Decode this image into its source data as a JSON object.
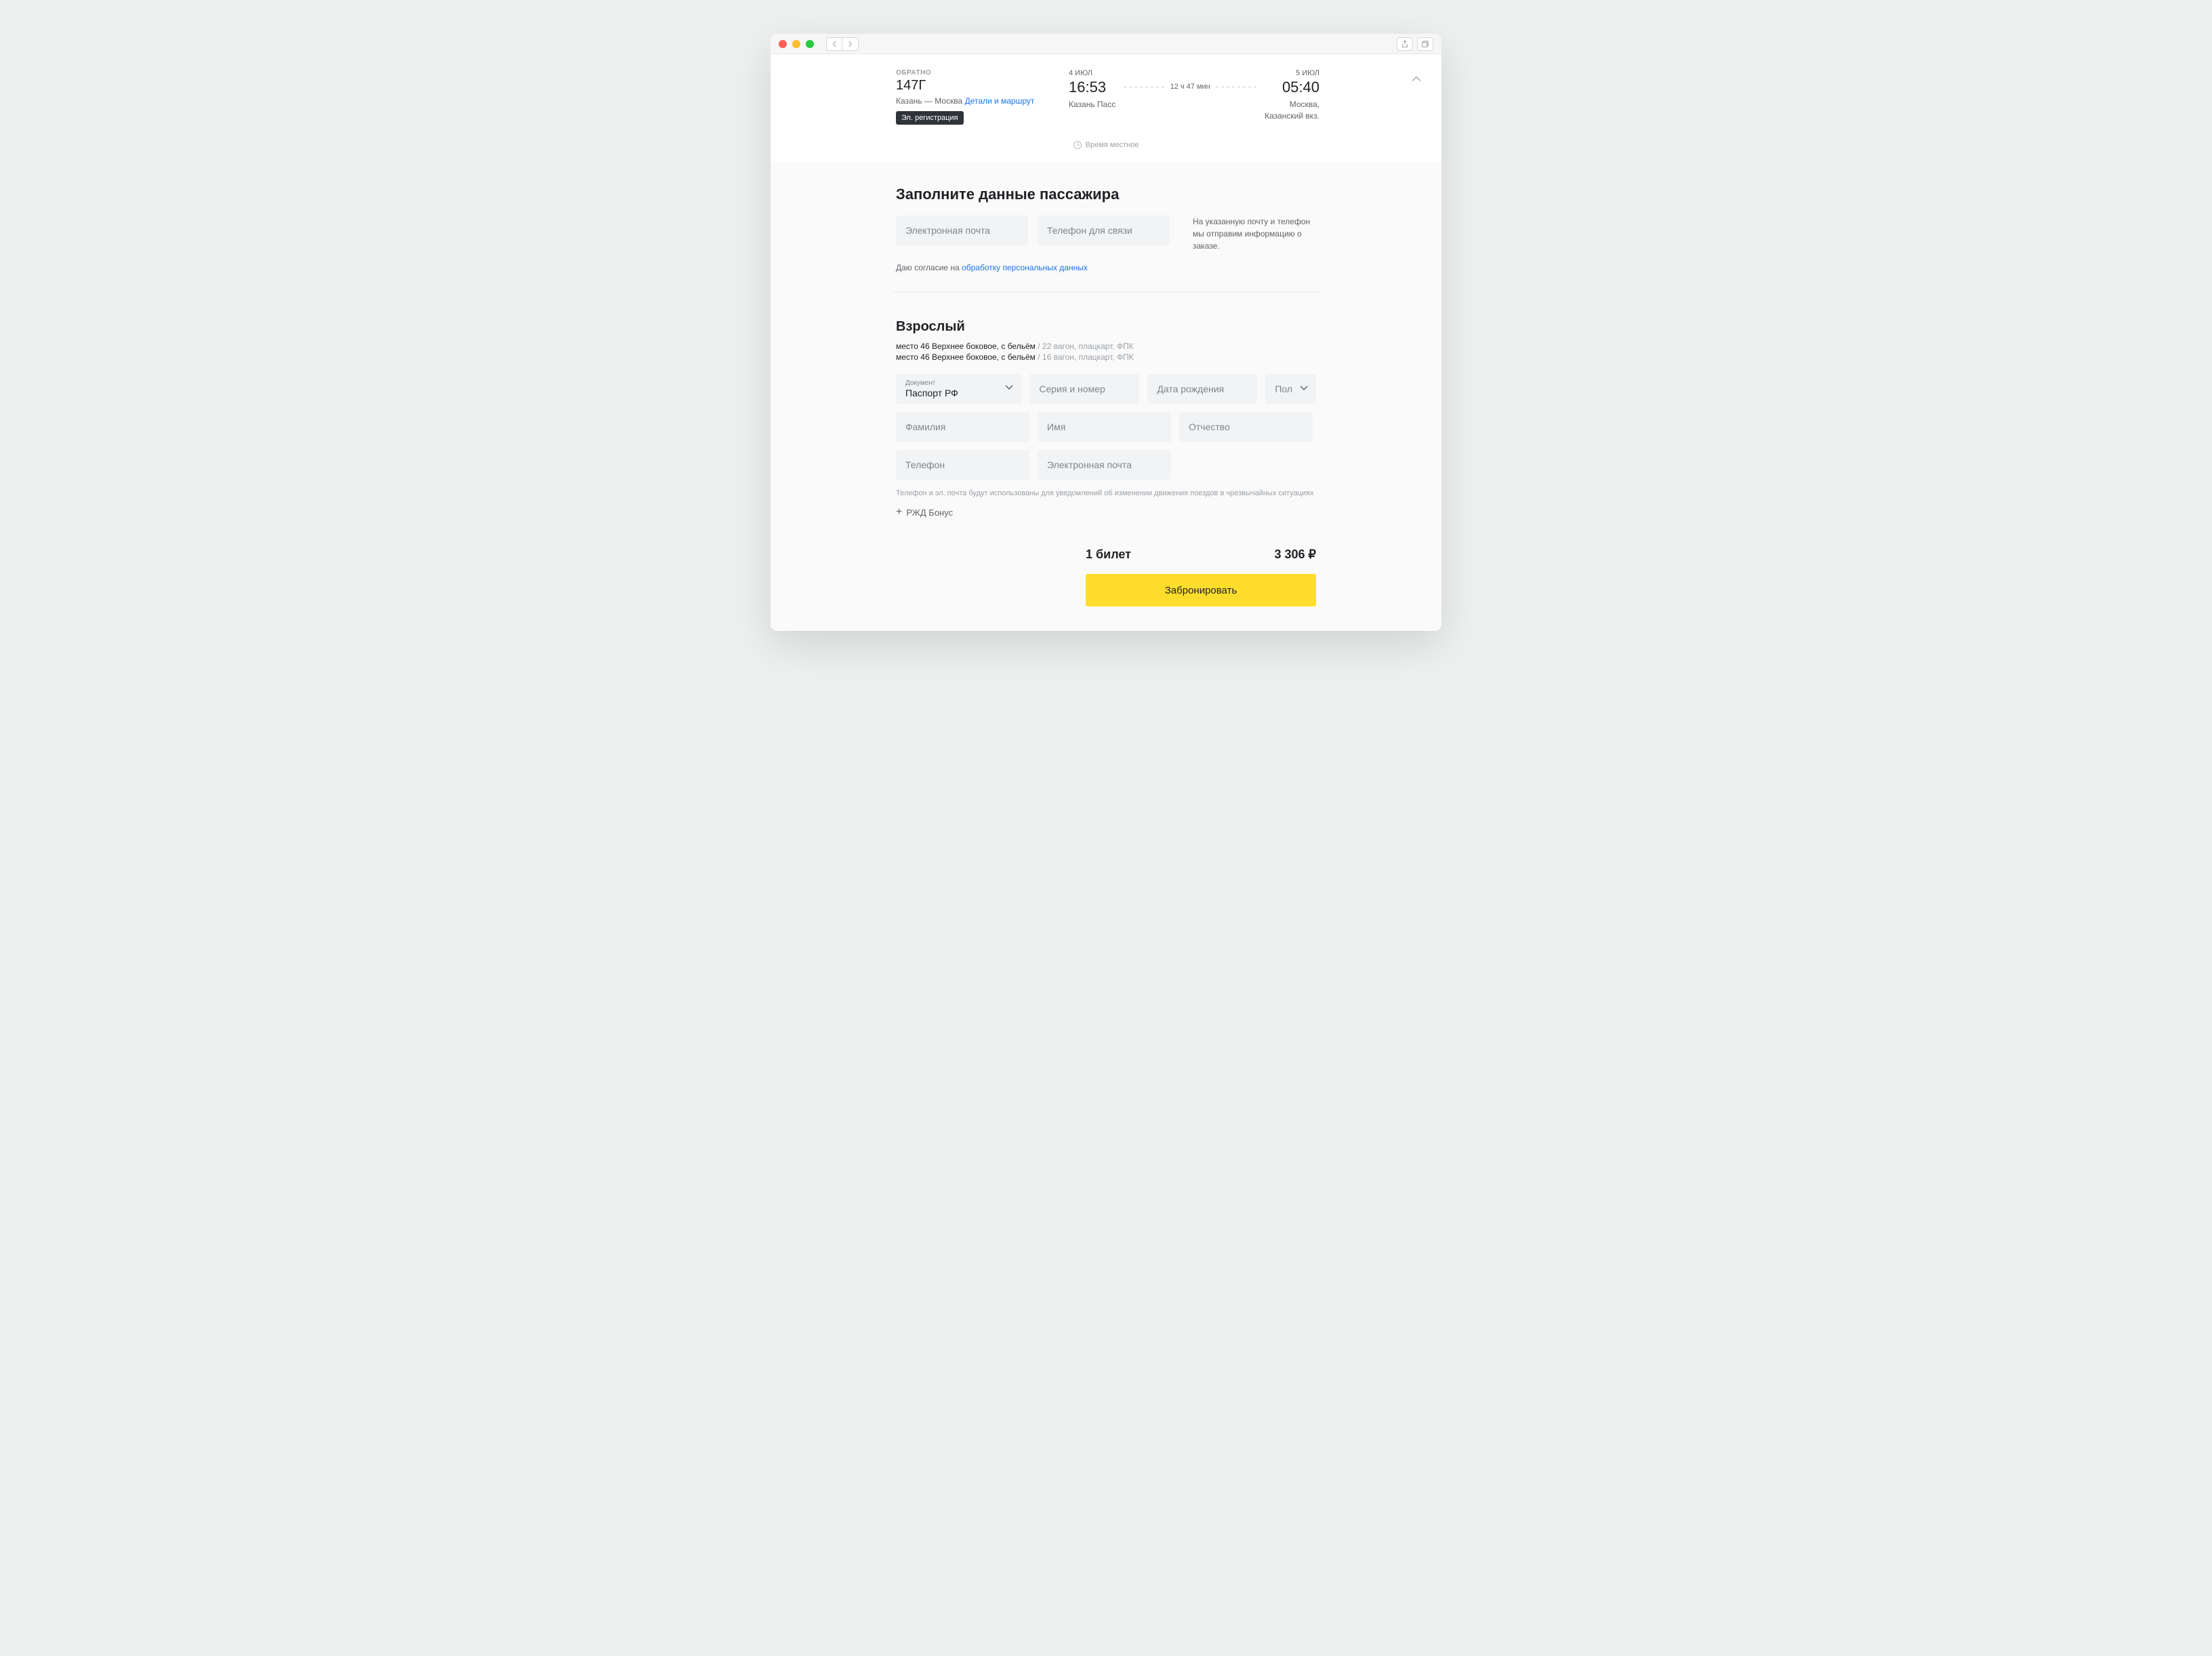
{
  "trip": {
    "direction_label": "ОБРАТНО",
    "train_number": "147Г",
    "from_city": "Казань",
    "to_city": "Москва",
    "route_separator": " — ",
    "details_link": "Детали и маршрут",
    "badge": "Эл. регистрация",
    "depart_date": "4 ИЮЛ",
    "depart_time": "16:53",
    "depart_station": "Казань Пасс",
    "duration": "12 ч 47 мин",
    "arrive_date": "5 ИЮЛ",
    "arrive_time": "05:40",
    "arrive_station_line1": "Москва,",
    "arrive_station_line2": "Казанский вкз.",
    "local_time_label": "Время местное"
  },
  "contact": {
    "title": "Заполните данные пассажира",
    "email_placeholder": "Электронная почта",
    "phone_placeholder": "Телефон для связи",
    "note": "На указанную почту и телефон мы отправим информацию о заказе.",
    "consent_prefix": "Даю согласие на ",
    "consent_link": "обработку персональных данных"
  },
  "passenger": {
    "title": "Взрослый",
    "seats": [
      {
        "main": "место 46 Верхнее боковое, с бельём",
        "sub": " / 22 вагон, плацкарт, ФПК"
      },
      {
        "main": "место 46 Верхнее боковое, с бельём",
        "sub": " / 16 вагон, плацкарт, ФПК"
      }
    ],
    "doc_label": "Документ",
    "doc_value": "Паспорт РФ",
    "series_placeholder": "Серия и номер",
    "dob_placeholder": "Дата рождения",
    "gender_placeholder": "Пол",
    "lastname_placeholder": "Фамилия",
    "firstname_placeholder": "Имя",
    "middlename_placeholder": "Отчество",
    "phone_placeholder": "Телефон",
    "email_placeholder": "Электронная почта",
    "notice": "Телефон и эл. почта будут использованы для уведомлений об изменении движения поездов в чрезвычайных ситуациях",
    "bonus_label": "РЖД Бонус"
  },
  "summary": {
    "count_label": "1 билет",
    "price": "3 306 ₽",
    "button": "Забронировать"
  }
}
